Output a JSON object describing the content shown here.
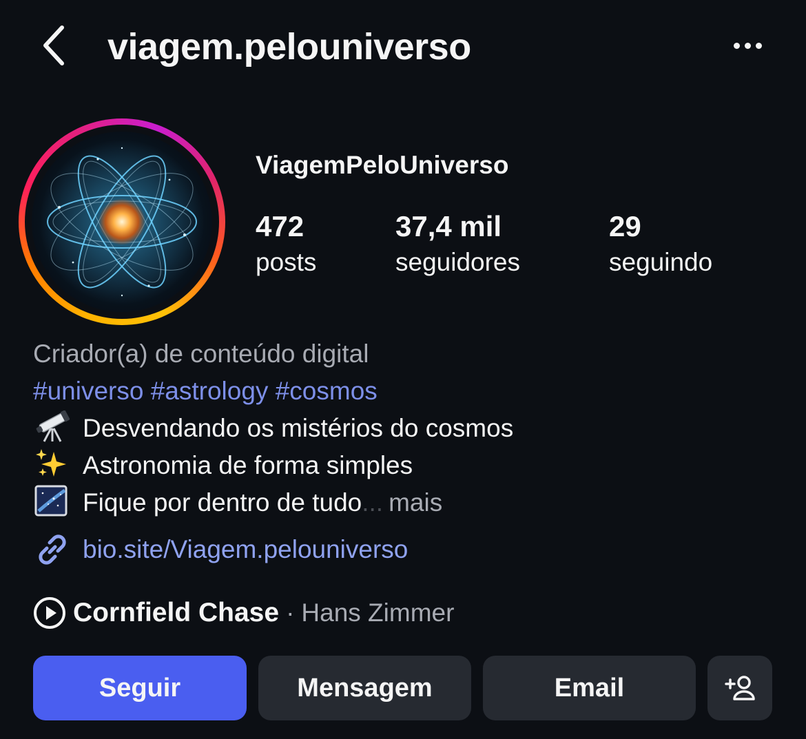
{
  "header": {
    "username": "viagem.pelouniverso",
    "back_icon": "chevron-left-icon",
    "more_icon": "more-horizontal-icon"
  },
  "profile": {
    "display_name": "ViagemPeloUniverso",
    "avatar": "atom-galaxy-avatar",
    "story_ring_colors": [
      "#ffb300",
      "#ff1f5a",
      "#c91ecf"
    ],
    "stats": {
      "posts": {
        "value": "472",
        "label": "posts"
      },
      "followers": {
        "value": "37,4 mil",
        "label": "seguidores"
      },
      "following": {
        "value": "29",
        "label": "seguindo"
      }
    }
  },
  "bio": {
    "category": "Criador(a) de conteúdo digital",
    "hashtags": [
      "#universo",
      "#astrology",
      "#cosmos"
    ],
    "lines": [
      {
        "emoji": "telescope-icon",
        "text": "Desvendando os mistérios do cosmos"
      },
      {
        "emoji": "sparkles-icon",
        "text": "Astronomia de forma simples"
      },
      {
        "emoji": "milky-way-icon",
        "text": "Fique por dentro de tudo"
      }
    ],
    "ellipsis": "...",
    "more_label": "mais",
    "link": {
      "icon": "link-icon",
      "text": "bio.site/Viagem.pelouniverso"
    }
  },
  "music": {
    "icon": "play-circle-icon",
    "song": "Cornfield Chase",
    "separator": "·",
    "artist": "Hans Zimmer"
  },
  "actions": {
    "follow_label": "Seguir",
    "message_label": "Mensagem",
    "email_label": "Email",
    "add_icon": "add-user-icon"
  },
  "colors": {
    "background": "#0c0f14",
    "follow_button": "#4a5ef0",
    "secondary_button": "#262a31",
    "hashtag": "#7d8fe8",
    "link": "#8fa2f0",
    "muted_text": "#a8abb3"
  }
}
